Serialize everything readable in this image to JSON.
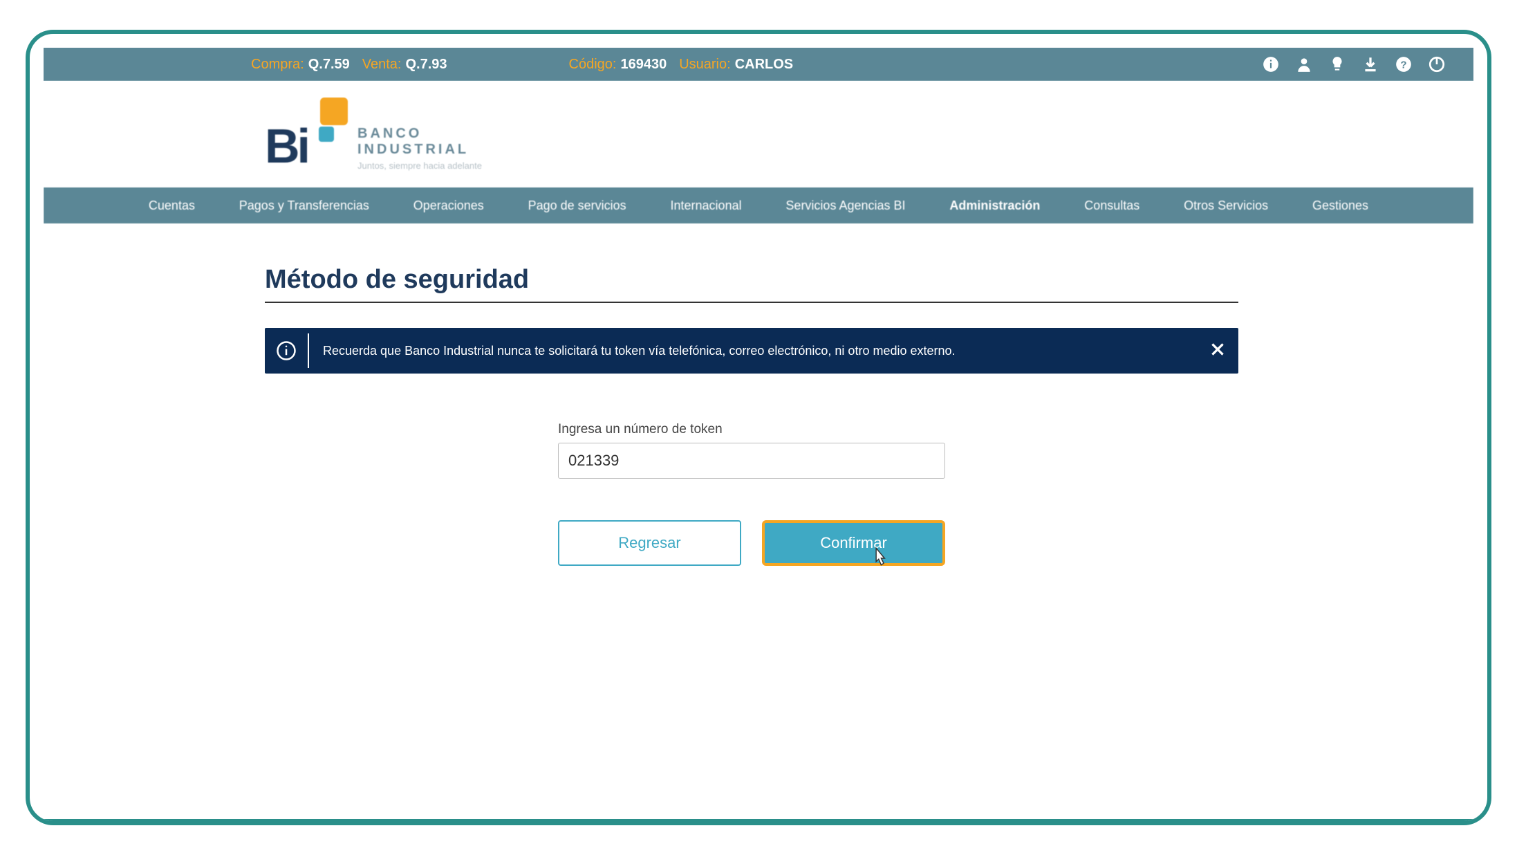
{
  "topbar": {
    "compra_label": "Compra:",
    "compra_value": "Q.7.59",
    "venta_label": "Venta:",
    "venta_value": "Q.7.93",
    "codigo_label": "Código:",
    "codigo_value": "169430",
    "usuario_label": "Usuario:",
    "usuario_value": "CARLOS"
  },
  "logo": {
    "mark": "Bi",
    "line1": "BANCO",
    "line2": "INDUSTRIAL",
    "tagline": "Juntos, siempre hacia adelante"
  },
  "nav": {
    "items": [
      {
        "label": "Cuentas"
      },
      {
        "label": "Pagos y Transferencias"
      },
      {
        "label": "Operaciones"
      },
      {
        "label": "Pago de servicios"
      },
      {
        "label": "Internacional"
      },
      {
        "label": "Servicios Agencias BI"
      },
      {
        "label": "Administración"
      },
      {
        "label": "Consultas"
      },
      {
        "label": "Otros Servicios"
      },
      {
        "label": "Gestiones"
      }
    ],
    "active_index": 6
  },
  "page": {
    "title": "Método de seguridad"
  },
  "alert": {
    "text": "Recuerda que Banco Industrial nunca te solicitará tu token vía telefónica, correo electrónico, ni otro medio externo."
  },
  "form": {
    "token_label": "Ingresa un número de token",
    "token_value": "021339",
    "back_label": "Regresar",
    "confirm_label": "Confirmar"
  }
}
